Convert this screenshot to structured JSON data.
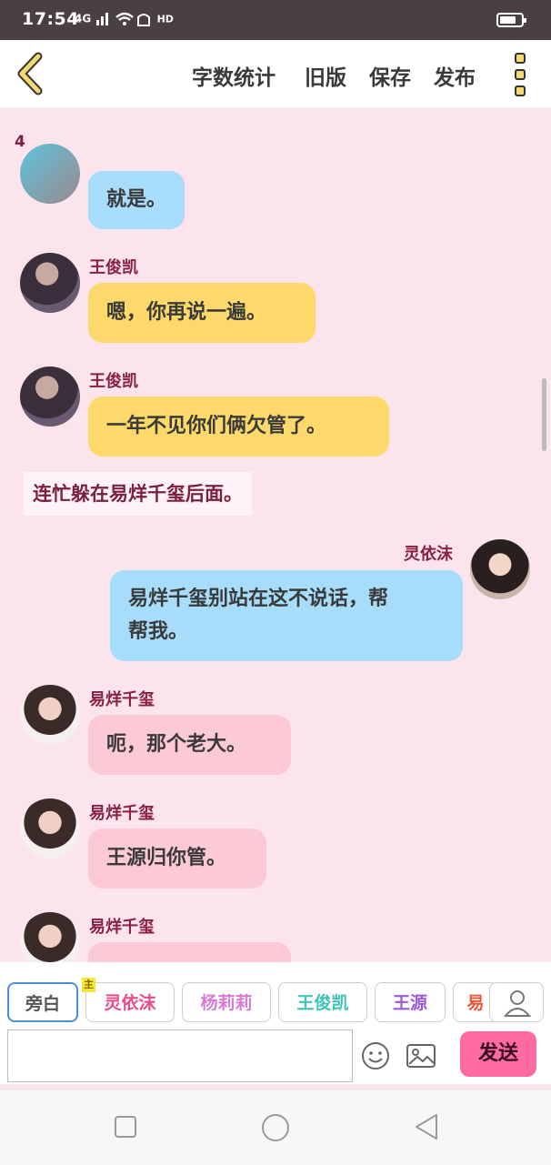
{
  "status": {
    "time": "17:54",
    "network": "4G",
    "wifi": "HD",
    "battery_level": 0.75
  },
  "toolbar": {
    "word_count": "字数统计",
    "old_version": "旧版",
    "save": "保存",
    "publish": "发布"
  },
  "chat": {
    "count_marker": "4",
    "messages": [
      {
        "speaker": "",
        "text": "就是。"
      },
      {
        "speaker": "王俊凯",
        "text": "嗯，你再说一遍。"
      },
      {
        "speaker": "王俊凯",
        "text": "一年不见你们俩欠管了。"
      },
      {
        "narration": "连忙躲在易烊千玺后面。"
      },
      {
        "speaker": "灵依沫",
        "lines": [
          "易烊千玺别站在这不说话，帮",
          "帮我。"
        ]
      },
      {
        "speaker": "易烊千玺",
        "text": "呃，那个老大。"
      },
      {
        "speaker": "易烊千玺",
        "text": "王源归你管。"
      },
      {
        "speaker": "易烊千玺",
        "text": ""
      }
    ]
  },
  "characters": {
    "narrator": "旁白",
    "host_badge": "主",
    "items": [
      "灵依沫",
      "杨莉莉",
      "王俊凯",
      "王源",
      "易"
    ],
    "colors": [
      "#e84a8a",
      "#d77ad6",
      "#3fc3b8",
      "#9b59e0",
      "#e8553a"
    ]
  },
  "input": {
    "value": "",
    "send_label": "发送"
  },
  "colors": {
    "background": "#fbe4ec",
    "blue_bubble": "#a7dcfa",
    "yellow_bubble": "#fcd96a",
    "pink_bubble": "#fcc9d6",
    "send": "#ff6aa0"
  }
}
